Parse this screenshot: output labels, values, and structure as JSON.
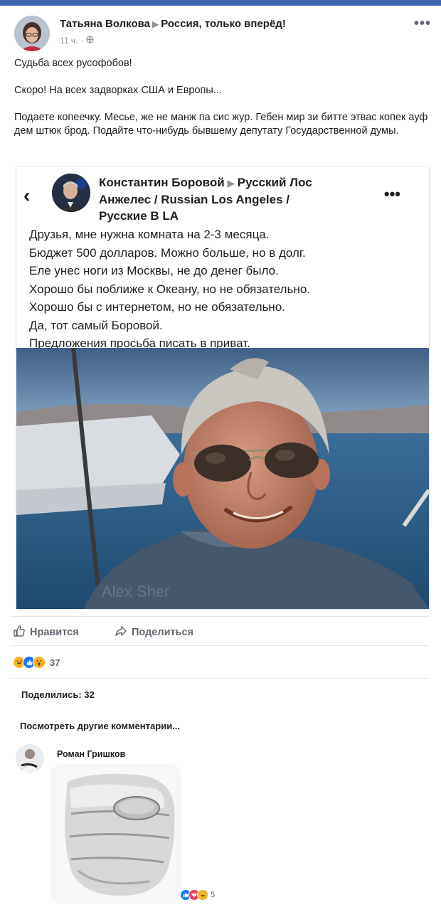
{
  "post": {
    "author": "Татьяна Волкова",
    "group": "Россия, только вперёд!",
    "time": "11 ч.",
    "more": "•••",
    "text": [
      "Судьба всех русофобов!",
      "Скоро! На всех задворках США и Европы...",
      "Подаете копеечку. Месье, же не манж па сис жур. Гебен мир зи битте этвас копек ауф дем штюк брод. Подайте что-нибудь бывшему депутату Государственной думы."
    ]
  },
  "shared_screenshot": {
    "back": "‹",
    "author": "Константин Боровой",
    "group_line1": "Русский Лос",
    "group_line2": "Анжелес / Russian Los Angeles /",
    "group_line3": "Русские В LA",
    "more": "•••",
    "lines": [
      "Друзья, мне нужна комната на 2-3 месяца.",
      "Бюджет 500 долларов. Можно больше, но в долг.",
      "Еле унес ноги из Москвы, не до денег было.",
      "Хорошо бы поближе к Океану, но не обязательно.",
      "Хорошо бы с интернетом, но не обязательно.",
      "Да, тот самый Боровой.",
      "Предложения просьба писать в приват."
    ],
    "watermark": "Alex Sher"
  },
  "actions": {
    "like": "Нравится",
    "share": "Поделиться"
  },
  "reactions": {
    "count": "37",
    "icons": [
      "haha-icon",
      "like-icon",
      "wow-icon"
    ]
  },
  "shares": "Поделились: 32",
  "more_comments": "Посмотреть другие комментарии...",
  "comment": {
    "author": "Роман Гришков",
    "reaction_count": "5",
    "reaction_icons": [
      "like-icon",
      "love-icon",
      "haha-icon"
    ]
  },
  "colors": {
    "brand": "#4267b2",
    "meta": "#90949c",
    "text": "#1c1e21",
    "action": "#606770"
  }
}
